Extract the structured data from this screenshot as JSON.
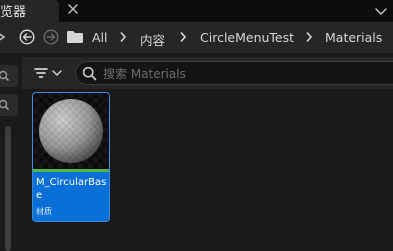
{
  "tab": {
    "title": "览器"
  },
  "breadcrumb": {
    "items": [
      "All",
      "内容",
      "CircleMenuTest",
      "Materials"
    ]
  },
  "search": {
    "placeholder": "搜索 Materials",
    "value": ""
  },
  "asset": {
    "name": "M_CircularBase",
    "type": "材质",
    "type_color": "#56b64a"
  },
  "colors": {
    "accent": "#0a70d8",
    "panel": "#262626",
    "background": "#1a1a1a"
  },
  "icons": [
    "close-icon",
    "window-menu-icon",
    "back-icon",
    "forward-icon",
    "folder-icon",
    "chevron-right-icon",
    "filter-icon",
    "search-icon",
    "material-sphere-icon"
  ]
}
